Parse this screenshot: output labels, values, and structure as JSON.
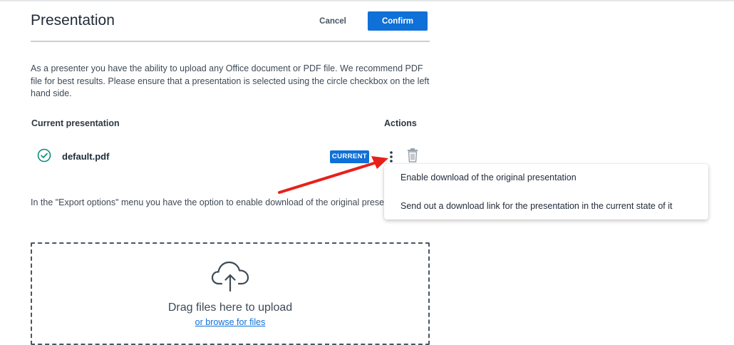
{
  "header": {
    "title": "Presentation",
    "cancel_label": "Cancel",
    "confirm_label": "Confirm"
  },
  "description": "As a presenter you have the ability to upload any Office document or PDF file. We recommend PDF file for best results. Please ensure that a presentation is selected using the circle checkbox on the left hand side.",
  "table": {
    "col_current": "Current presentation",
    "col_actions": "Actions",
    "rows": [
      {
        "filename": "default.pdf",
        "badge": "CURRENT",
        "selected_icon": "check-circle-icon"
      }
    ]
  },
  "export_text": "In the \"Export options\" menu you have the option to enable download of the original presentation and to provide users with a downloadable link with annotations in public",
  "export_menu": {
    "items": [
      {
        "label": "Enable download of the original presentation"
      },
      {
        "label": "Send out a download link for the presentation in the current state of it"
      }
    ]
  },
  "upload": {
    "icon": "cloud-upload-icon",
    "drag_text": "Drag files here to upload",
    "browse_text": "or browse for files"
  },
  "colors": {
    "accent": "#0f70d7",
    "success": "#0a8f7a",
    "annotation_arrow": "#e8201a"
  }
}
